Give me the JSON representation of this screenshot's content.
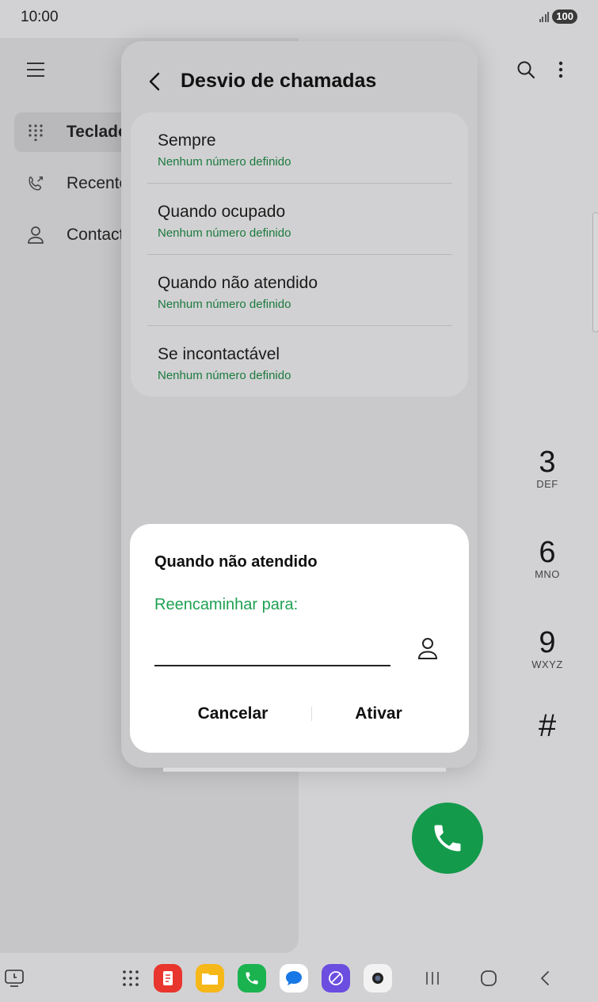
{
  "status_bar": {
    "time": "10:00",
    "battery": "100"
  },
  "nav": {
    "items": [
      {
        "label": "Teclado",
        "icon": "dialpad-icon",
        "active": true
      },
      {
        "label": "Recentes",
        "icon": "recent-calls-icon",
        "active": false
      },
      {
        "label": "Contactos",
        "icon": "contact-icon",
        "active": false
      }
    ]
  },
  "keypad": {
    "keys": [
      {
        "num": "3",
        "letters": "DEF"
      },
      {
        "num": "6",
        "letters": "MNO"
      },
      {
        "num": "9",
        "letters": "WXYZ"
      }
    ],
    "hash": "#"
  },
  "popup": {
    "title": "Desvio de chamadas",
    "options": [
      {
        "title": "Sempre",
        "subtitle": "Nenhum número definido"
      },
      {
        "title": "Quando ocupado",
        "subtitle": "Nenhum número definido"
      },
      {
        "title": "Quando não atendido",
        "subtitle": "Nenhum número definido"
      },
      {
        "title": "Se incontactável",
        "subtitle": "Nenhum número definido"
      }
    ]
  },
  "dialog": {
    "title": "Quando não atendido",
    "label": "Reencaminhar para:",
    "input_value": "",
    "cancel": "Cancelar",
    "confirm": "Ativar"
  },
  "colors": {
    "accent_green": "#1ea152",
    "subtitle_green": "#1c7a3e",
    "call_button": "#139a4b"
  },
  "taskbar": {
    "apps": [
      "app-drawer-icon",
      "notes-app-icon",
      "my-files-app-icon",
      "phone-app-icon",
      "messages-app-icon",
      "internet-app-icon",
      "camera-app-icon"
    ],
    "nav_buttons": [
      "recents-button",
      "home-button",
      "back-button"
    ]
  }
}
